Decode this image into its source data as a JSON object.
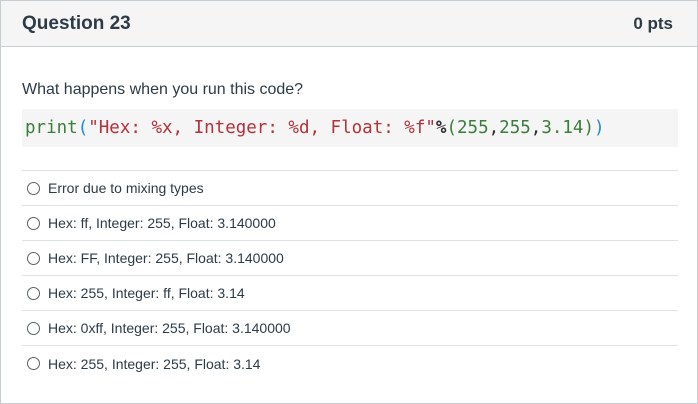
{
  "header": {
    "title": "Question 23",
    "points": "0 pts"
  },
  "question": {
    "prompt": "What happens when you run this code?",
    "code": {
      "func": "print",
      "open_paren": "(",
      "string": "\"Hex: %x, Integer: %d, Float: %f\"",
      "operator": "%",
      "open_tuple": "(",
      "num1": "255",
      "comma1": ",",
      "num2": "255",
      "comma2": ",",
      "num3": "3.14",
      "close_tuple": ")",
      "close_paren": ")"
    }
  },
  "answers": [
    {
      "label": "Error due to mixing types"
    },
    {
      "label": "Hex: ff, Integer: 255, Float: 3.140000"
    },
    {
      "label": "Hex: FF, Integer: 255, Float: 3.140000"
    },
    {
      "label": "Hex: 255, Integer: ff, Float: 3.14"
    },
    {
      "label": "Hex: 0xff, Integer: 255, Float: 3.140000"
    },
    {
      "label": "Hex: 255, Integer: 255, Float: 3.14"
    }
  ]
}
